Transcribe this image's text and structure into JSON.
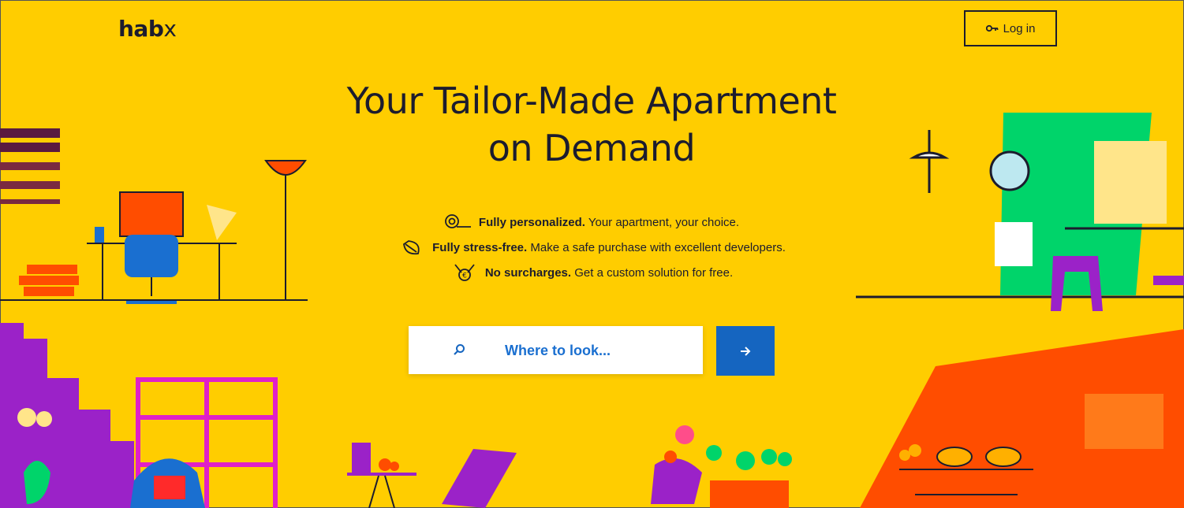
{
  "header": {
    "logo_text": "hab",
    "logo_mark": "x",
    "login_label": "Log in",
    "login_icon": "key-icon"
  },
  "hero": {
    "title_line1": "Your Tailor-Made Apartment",
    "title_line2": "on Demand",
    "features": [
      {
        "icon": "personalize-icon",
        "bold": "Fully personalized.",
        "text": " Your apartment, your choice."
      },
      {
        "icon": "leaf-icon",
        "bold": "Fully stress-free.",
        "text": " Make a safe purchase with excellent developers."
      },
      {
        "icon": "medal-euro-icon",
        "bold": "No surcharges.",
        "text": " Get a custom solution for free."
      }
    ]
  },
  "search": {
    "placeholder": "Where to look...",
    "value": "",
    "icon": "search-icon",
    "submit_icon": "arrow-right-icon"
  },
  "colors": {
    "background": "#ffcd00",
    "text": "#1c1c2e",
    "accent_blue": "#1565c0",
    "orange": "#ff4d00",
    "magenta": "#e020c8",
    "purple": "#9b22c8",
    "green": "#00d46a"
  }
}
